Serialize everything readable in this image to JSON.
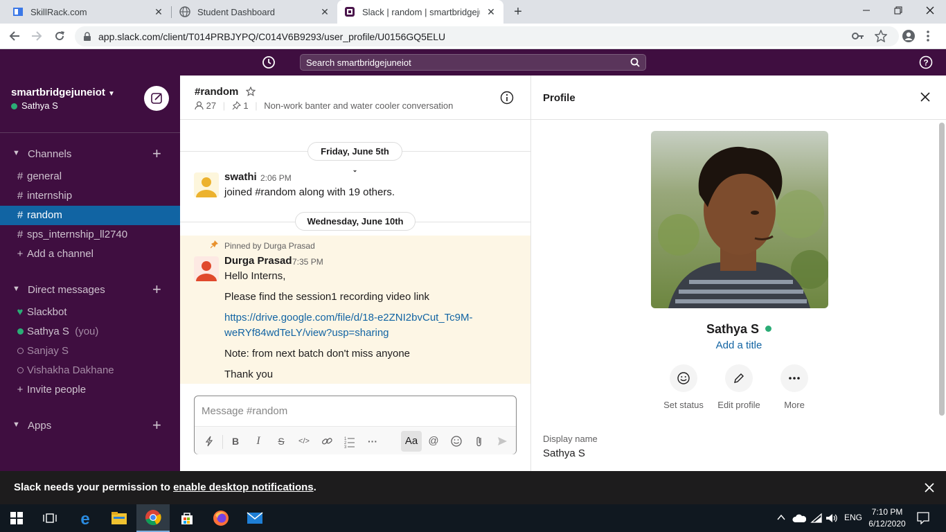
{
  "browser": {
    "tabs": [
      {
        "title": "SkillRack.com"
      },
      {
        "title": "Student Dashboard"
      },
      {
        "title": "Slack | random | smartbridgejune"
      }
    ],
    "url": "app.slack.com/client/T014PRBJYPQ/C014V6B9293/user_profile/U0156GQ5ELU"
  },
  "topbar": {
    "search_placeholder": "Search smartbridgejuneiot"
  },
  "sidebar": {
    "workspace": "smartbridgejuneiot",
    "user": "Sathya S",
    "channels_header": "Channels",
    "channels": [
      {
        "label": "general"
      },
      {
        "label": "internship"
      },
      {
        "label": "random"
      },
      {
        "label": "sps_internship_ll2740"
      }
    ],
    "add_channel": "Add a channel",
    "dm_header": "Direct messages",
    "dms": [
      {
        "label": "Slackbot"
      },
      {
        "label": "Sathya S",
        "suffix": "(you)"
      },
      {
        "label": "Sanjay S"
      },
      {
        "label": "Vishakha Dakhane"
      }
    ],
    "invite": "Invite people",
    "apps_header": "Apps"
  },
  "channel": {
    "name": "#random",
    "members": "27",
    "pins": "1",
    "topic": "Non-work banter and water cooler conversation",
    "day1": "Friday, June 5th",
    "day2": "Wednesday, June 10th",
    "msg1": {
      "author": "swathi",
      "time": "2:06 PM",
      "text": "joined #random along with 19 others."
    },
    "pinned_by": "Pinned by Durga Prasad",
    "msg2": {
      "author": "Durga Prasad",
      "time": "7:35 PM",
      "line1": "Hello Interns,",
      "line2": "Please find the session1 recording video link",
      "link1": "https://drive.google.com/file/d/18-e2ZNI2bvCut_Tc9M-",
      "link2": "weRYf84wdTeLY/view?usp=sharing",
      "line3": "Note: from next batch don't miss anyone",
      "line4": "Thank you"
    },
    "input_placeholder": "Message #random"
  },
  "profile": {
    "header": "Profile",
    "name": "Sathya S",
    "add_title": "Add a title",
    "actions": [
      "Set status",
      "Edit profile",
      "More"
    ],
    "display_name_label": "Display name",
    "display_name": "Sathya S"
  },
  "banner": {
    "prefix": "Slack needs your permission to ",
    "link": "enable desktop notifications",
    "suffix": "."
  },
  "taskbar": {
    "lang": "ENG",
    "time": "7:10 PM",
    "date": "6/12/2020"
  },
  "colors": {
    "aubergine": "#3f0e40",
    "selected": "#1164a3",
    "link": "#1264a3",
    "presence": "#2bac76",
    "pinned_bg": "#fdf6e5"
  }
}
